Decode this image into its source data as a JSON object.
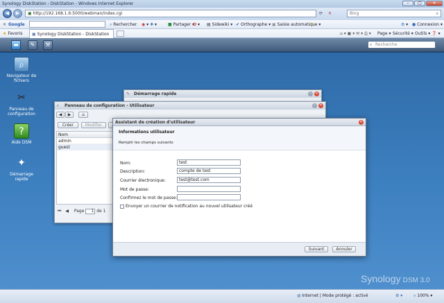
{
  "browser": {
    "window_title": "Synology DiskStation - DiskStation - Windows Internet Explorer",
    "address": "http://192.168.1.6:5000/webman/index.cgi",
    "search_placeholder": "Bing",
    "google_label": "Google",
    "toolbar1": {
      "search_btn": "Rechercher",
      "share_btn": "Partager",
      "sidewiki_btn": "Sidewiki",
      "spell_btn": "Orthographe",
      "autofill_btn": "Saisie automatique",
      "connect_btn": "Connexion"
    },
    "favorites_label": "Favoris",
    "tab_label": "Synology DiskStation - DiskStation",
    "toolbar2": {
      "page_menu": "Page",
      "security_menu": "Sécurité",
      "tools_menu": "Outils"
    }
  },
  "dsm": {
    "search_placeholder": "Recherche",
    "desktop_icons": [
      {
        "label": "Navigateur de fichiers",
        "icon": "magnifier-icon"
      },
      {
        "label": "Panneau de configuration",
        "icon": "tools-icon"
      },
      {
        "label": "Aide DSM",
        "icon": "help-icon"
      },
      {
        "label": "Démarrage rapide",
        "icon": "wand-icon"
      }
    ],
    "brand": "Synology",
    "brand_version": "DSM 3.0"
  },
  "quickstart_window": {
    "title": "Démarrage rapide"
  },
  "cp_window": {
    "title": "Panneau de configuration - Utilisateur",
    "create_btn": "Créer",
    "modify_btn": "Modifier",
    "column_name": "Nom",
    "users": [
      "admin",
      "guest"
    ],
    "page_label": "Page",
    "page_value": "1",
    "page_of": "de 1"
  },
  "wizard": {
    "title": "Assistant de création d'utilisateur",
    "section_title": "Informations utilisateur",
    "instructions": "Remplir les champs suivants",
    "fields": [
      {
        "label": "Nom:",
        "value": "test"
      },
      {
        "label": "Description:",
        "value": "compte de test"
      },
      {
        "label": "Courrier électronique:",
        "value": "test@test.com"
      },
      {
        "label": "Mot de passe:",
        "value": ""
      },
      {
        "label": "Confirmez le mot de passe:",
        "value": ""
      }
    ],
    "notify_checkbox": "Envoyer un courrier de notification au nouvel utilisateur créé",
    "next_btn": "Suivant",
    "cancel_btn": "Annuler"
  },
  "statusbar": {
    "zone": "Internet | Mode protégé : activé",
    "zoom": "100%"
  },
  "colors": {
    "desktop": "#3d80c0",
    "close_red": "#d94a3a",
    "title_blue": "#c9dbee"
  }
}
